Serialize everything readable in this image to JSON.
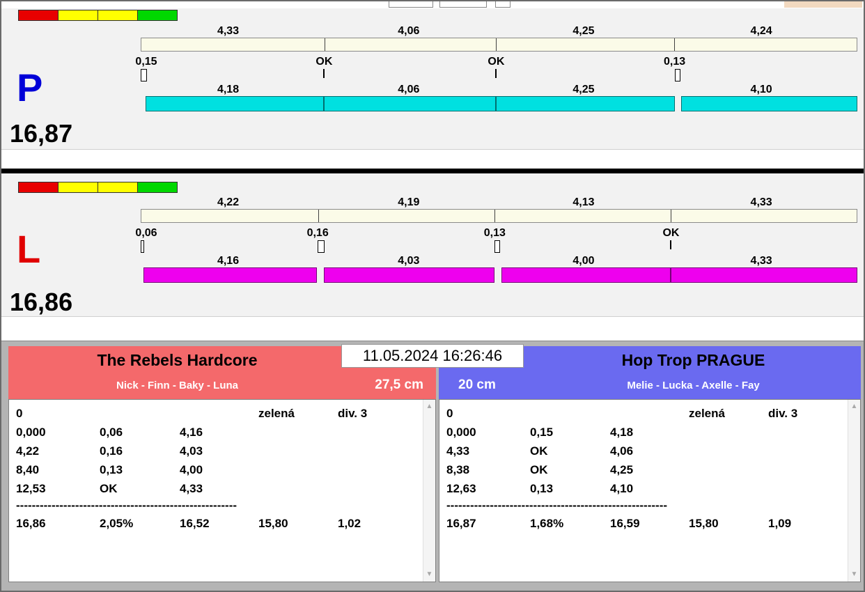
{
  "window": {
    "datetime": "11.05.2024 16:26:46"
  },
  "colors": {
    "lane_p_letter": "#0000d8",
    "lane_l_letter": "#e00000",
    "bar_top": "#fbfbe8",
    "bar_p": "#00e0e0",
    "bar_l": "#ee00ee",
    "team_left_bg": "#f4696b",
    "team_right_bg": "#6a6af0",
    "light_red": "#e80000",
    "light_yellow": "#ffff00",
    "light_green": "#00d800"
  },
  "icons": {
    "scroll_up": "▲",
    "scroll_down": "▼"
  },
  "lanes": {
    "p": {
      "letter": "P",
      "total": "16,87",
      "top_segments": [
        "4,33",
        "4,06",
        "4,25",
        "4,24"
      ],
      "exchanges": [
        "0,15",
        "OK",
        "OK",
        "0,13"
      ],
      "bottom_segments": [
        "4,18",
        "4,06",
        "4,25",
        "4,10"
      ]
    },
    "l": {
      "letter": "L",
      "total": "16,86",
      "top_segments": [
        "4,22",
        "4,19",
        "4,13",
        "4,33"
      ],
      "exchanges": [
        "0,06",
        "0,16",
        "0,13",
        "OK"
      ],
      "bottom_segments": [
        "4,16",
        "4,03",
        "4,00",
        "4,33"
      ]
    }
  },
  "teams": {
    "left": {
      "name": "The Rebels Hardcore",
      "members": "Nick - Finn - Baky - Luna",
      "height": "27,5 cm",
      "status_row": [
        "0",
        "zelená",
        "div. 3"
      ],
      "rows": [
        [
          "0,000",
          "0,06",
          "4,16"
        ],
        [
          "4,22",
          "0,16",
          "4,03"
        ],
        [
          "8,40",
          "0,13",
          "4,00"
        ],
        [
          "12,53",
          "OK",
          "4,33"
        ]
      ],
      "separator": "--------------------------------------------------------",
      "summary": [
        "16,86",
        "2,05%",
        "16,52",
        "15,80",
        "1,02"
      ]
    },
    "right": {
      "name": "Hop Trop PRAGUE",
      "members": "Melie - Lucka - Axelle - Fay",
      "height": "20 cm",
      "status_row": [
        "0",
        "zelená",
        "div. 3"
      ],
      "rows": [
        [
          "0,000",
          "0,15",
          "4,18"
        ],
        [
          "4,33",
          "OK",
          "4,06"
        ],
        [
          "8,38",
          "OK",
          "4,25"
        ],
        [
          "12,63",
          "0,13",
          "4,10"
        ]
      ],
      "separator": "--------------------------------------------------------",
      "summary": [
        "16,87",
        "1,68%",
        "16,59",
        "15,80",
        "1,09"
      ]
    }
  }
}
